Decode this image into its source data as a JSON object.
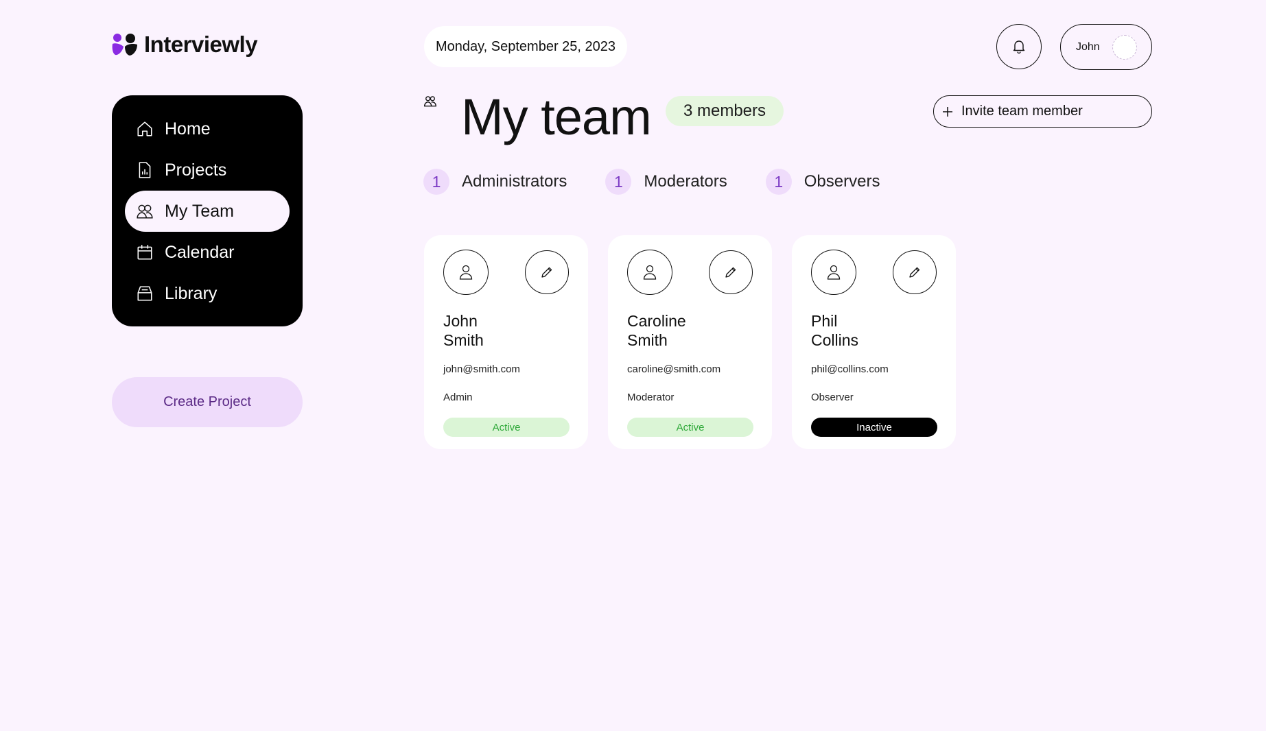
{
  "app": {
    "name": "Interviewly",
    "brand_color": "#8a2be2"
  },
  "header": {
    "date": "Monday, September 25, 2023",
    "user_name": "John",
    "bell_icon": "bell-icon"
  },
  "sidebar": {
    "items": [
      {
        "label": "Home",
        "icon": "home-icon",
        "active": false
      },
      {
        "label": "Projects",
        "icon": "file-chart-icon",
        "active": false
      },
      {
        "label": "My Team",
        "icon": "users-icon",
        "active": true
      },
      {
        "label": "Calendar",
        "icon": "calendar-icon",
        "active": false
      },
      {
        "label": "Library",
        "icon": "archive-icon",
        "active": false
      }
    ],
    "create_label": "Create Project"
  },
  "main": {
    "title": "My team",
    "members_count": "3 members",
    "invite_label": "Invite team member",
    "roles": [
      {
        "count": "1",
        "label": "Administrators"
      },
      {
        "count": "1",
        "label": "Moderators"
      },
      {
        "count": "1",
        "label": "Observers"
      }
    ],
    "members": [
      {
        "first": "John",
        "last": "Smith",
        "email": "john@smith.com",
        "role": "Admin",
        "status": "Active"
      },
      {
        "first": "Caroline",
        "last": "Smith",
        "email": "caroline@smith.com",
        "role": "Moderator",
        "status": "Active"
      },
      {
        "first": "Phil",
        "last": "Collins",
        "email": "phil@collins.com",
        "role": "Observer",
        "status": "Inactive"
      }
    ]
  }
}
